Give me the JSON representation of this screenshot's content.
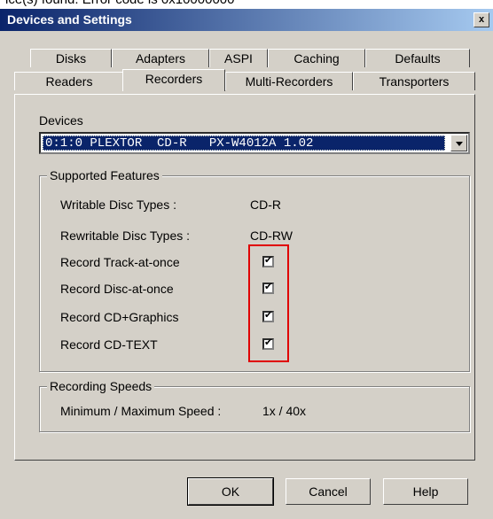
{
  "top_strip_text": "ice(s) found.  Error code is 0x10000000",
  "window": {
    "title": "Devices and Settings",
    "close_label": "x"
  },
  "tabs_row1": [
    "Disks",
    "Adapters",
    "ASPI",
    "Caching",
    "Defaults"
  ],
  "tabs_row2": [
    "Readers",
    "Recorders",
    "Multi-Recorders",
    "Transporters"
  ],
  "active_tab": "Recorders",
  "devices": {
    "label": "Devices",
    "selected": "0:1:0 PLEXTOR  CD-R   PX-W4012A 1.02"
  },
  "supported_features": {
    "title": "Supported Features",
    "writable_label": "Writable Disc Types :",
    "writable_value": "CD-R",
    "rewritable_label": "Rewritable Disc Types :",
    "rewritable_value": "CD-RW",
    "options": [
      {
        "label": "Record Track-at-once",
        "checked": true
      },
      {
        "label": "Record Disc-at-once",
        "checked": true
      },
      {
        "label": "Record CD+Graphics",
        "checked": true
      },
      {
        "label": "Record CD-TEXT",
        "checked": true
      }
    ]
  },
  "recording_speeds": {
    "title": "Recording Speeds",
    "label": "Minimum / Maximum Speed :",
    "value": "1x  /  40x"
  },
  "buttons": {
    "ok": "OK",
    "cancel": "Cancel",
    "help": "Help"
  },
  "colors": {
    "highlight": "#0a246a",
    "annotation": "#e00000"
  }
}
